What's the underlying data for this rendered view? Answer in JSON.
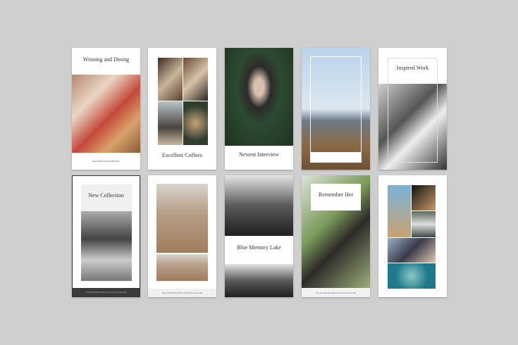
{
  "cards": [
    {
      "title": "Winning and Dining",
      "hashtag": "#WININGANDDINING"
    },
    {
      "title": "Excellent Coffees"
    },
    {
      "title": "Newest Interview"
    },
    {
      "title": "Bohemian"
    },
    {
      "title": "Inspired Work"
    },
    {
      "title": "New Collection",
      "footer": "You can find the link in my bio for more info"
    },
    {
      "footer": "You can find the link in my bio for more info"
    },
    {
      "title": "Blue Memory Lake"
    },
    {
      "title": "Remember Her",
      "footer": "You can find the link in my bio for more info"
    },
    {}
  ]
}
